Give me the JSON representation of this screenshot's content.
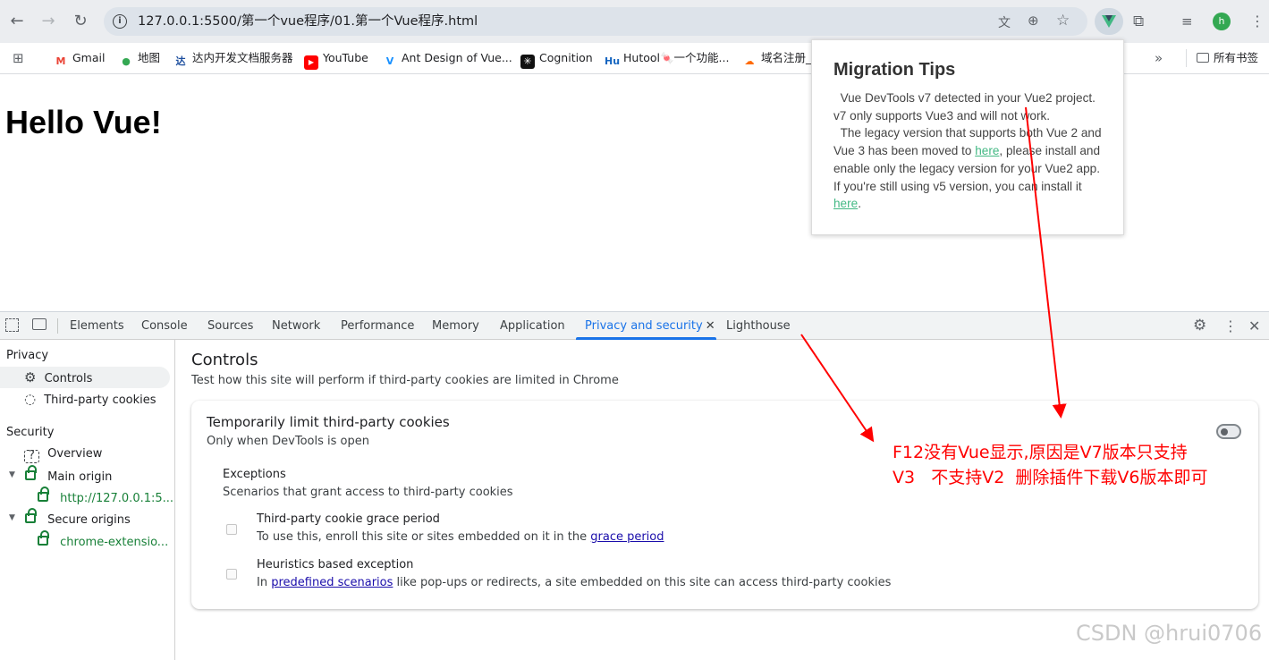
{
  "browser": {
    "url": "127.0.0.1:5500/第一个vue程序/01.第一个Vue程序.html",
    "profile_initial": "h",
    "bookmarks": [
      "Gmail",
      "地图",
      "达内开发文档服务器",
      "YouTube",
      "Ant Design of Vue...",
      "Cognition",
      "Hutool🍬一个功能...",
      "域名注册_"
    ],
    "bookmarks_overflow": "»",
    "bookmarks_folder": "所有书签"
  },
  "page": {
    "heading": "Hello Vue!"
  },
  "migration_tips": {
    "title": "Migration Tips",
    "line1": "Vue DevTools v7 detected in your Vue2 project. v7 only supports Vue3 and will not work.",
    "line2_pre": "The legacy version that supports both Vue 2 and Vue 3 has been moved to ",
    "link1": "here",
    "line2_post": ", please install and enable only the legacy version for your Vue2 app. If you're still using v5 version, you can install it ",
    "link2": "here",
    "line2_end": "."
  },
  "devtools": {
    "tabs": [
      "Elements",
      "Console",
      "Sources",
      "Network",
      "Performance",
      "Memory",
      "Application",
      "Privacy and security",
      "Lighthouse"
    ],
    "active_tab": "Privacy and security",
    "sidebar": {
      "privacy_header": "Privacy",
      "controls": "Controls",
      "third_party": "Third-party cookies",
      "security_header": "Security",
      "overview": "Overview",
      "main_origin": "Main origin",
      "main_origin_url": "http://127.0.0.1:5...",
      "secure_origins": "Secure origins",
      "secure_origin_url": "chrome-extensio..."
    },
    "main": {
      "title": "Controls",
      "desc": "Test how this site will perform if third-party cookies are limited in Chrome",
      "card_title": "Temporarily limit third-party cookies",
      "card_sub": "Only when DevTools is open",
      "exceptions_title": "Exceptions",
      "exceptions_desc": "Scenarios that grant access to third-party cookies",
      "grace_title": "Third-party cookie grace period",
      "grace_desc_pre": "To use this, enroll this site or sites embedded on it in the ",
      "grace_link": "grace period",
      "heur_title": "Heuristics based exception",
      "heur_pre": "In ",
      "heur_link": "predefined scenarios",
      "heur_post": " like pop-ups or redirects, a site embedded on this site can access third-party cookies"
    }
  },
  "annotation": {
    "line1": "F12没有Vue显示,原因是V7版本只支持",
    "line2": "V3   不支持V2  删除插件下载V6版本即可",
    "color": "#ff0000"
  },
  "watermark": "CSDN @hrui0706"
}
